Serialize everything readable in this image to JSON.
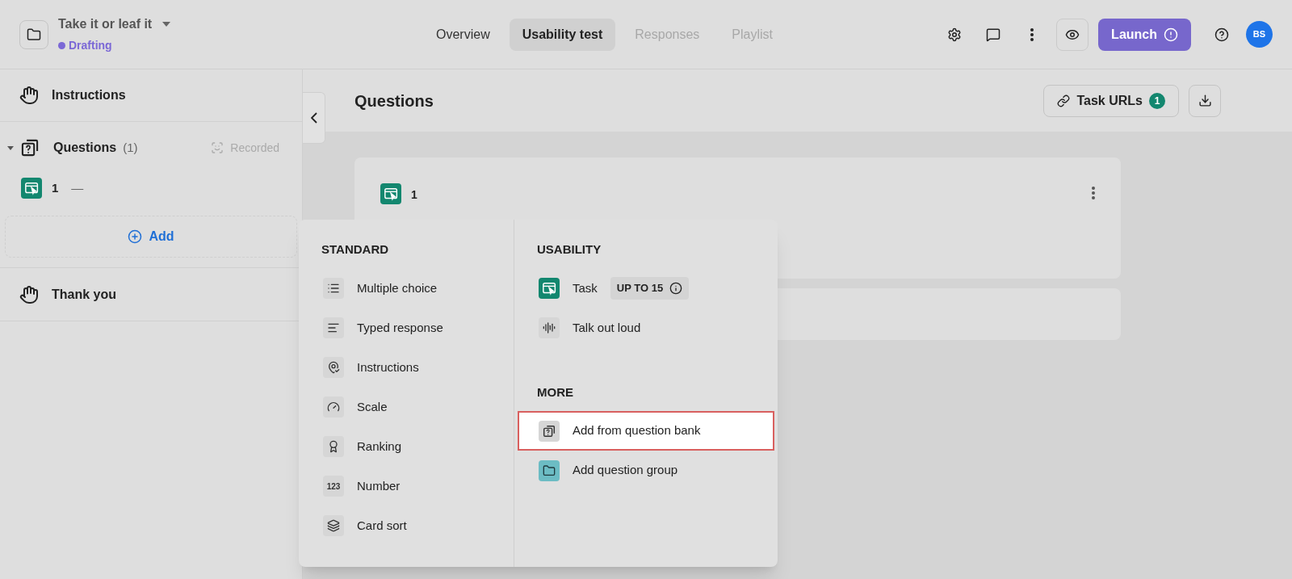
{
  "header": {
    "title": "Take it or leaf it",
    "status": {
      "label": "Drafting",
      "color": "#7b68d6"
    },
    "tabs": [
      {
        "label": "Overview",
        "selected": false,
        "disabled": false
      },
      {
        "label": "Usability test",
        "selected": true,
        "disabled": false
      },
      {
        "label": "Responses",
        "selected": false,
        "disabled": true
      },
      {
        "label": "Playlist",
        "selected": false,
        "disabled": true
      }
    ],
    "launch": "Launch",
    "avatar": "BS"
  },
  "sidebar": {
    "instructions": "Instructions",
    "questions": {
      "label": "Questions",
      "count": "(1)",
      "expanded": true,
      "recorded": "Recorded",
      "items": [
        {
          "number": "1",
          "title": "—"
        }
      ]
    },
    "add": "Add",
    "thank_you": "Thank you"
  },
  "main": {
    "title": "Questions",
    "task_urls": {
      "label": "Task URLs",
      "count": "1"
    },
    "cards": [
      {
        "number": "1"
      }
    ]
  },
  "menu": {
    "sections": [
      {
        "title": "STANDARD",
        "items": [
          {
            "kind": "list",
            "label": "Multiple choice",
            "selected": false
          },
          {
            "kind": "lines",
            "label": "Typed response",
            "selected": false
          },
          {
            "kind": "pin",
            "label": "Instructions",
            "selected": false
          },
          {
            "kind": "gauge",
            "label": "Scale",
            "selected": false
          },
          {
            "kind": "award",
            "label": "Ranking",
            "selected": false
          },
          {
            "kind": "digits",
            "glyph": "123",
            "label": "Number",
            "selected": false
          },
          {
            "kind": "cards",
            "label": "Card sort",
            "selected": false
          }
        ]
      },
      {
        "title": "USABILITY",
        "items": [
          {
            "kind": "task",
            "label": "Task",
            "badge": "UP TO 15",
            "selected": false
          },
          {
            "kind": "audio",
            "label": "Talk out loud",
            "selected": false
          }
        ]
      },
      {
        "title": "MORE",
        "items": [
          {
            "kind": "bank",
            "label": "Add from question bank",
            "selected": true
          },
          {
            "kind": "folder",
            "label": "Add question group",
            "selected": false
          }
        ]
      }
    ]
  }
}
